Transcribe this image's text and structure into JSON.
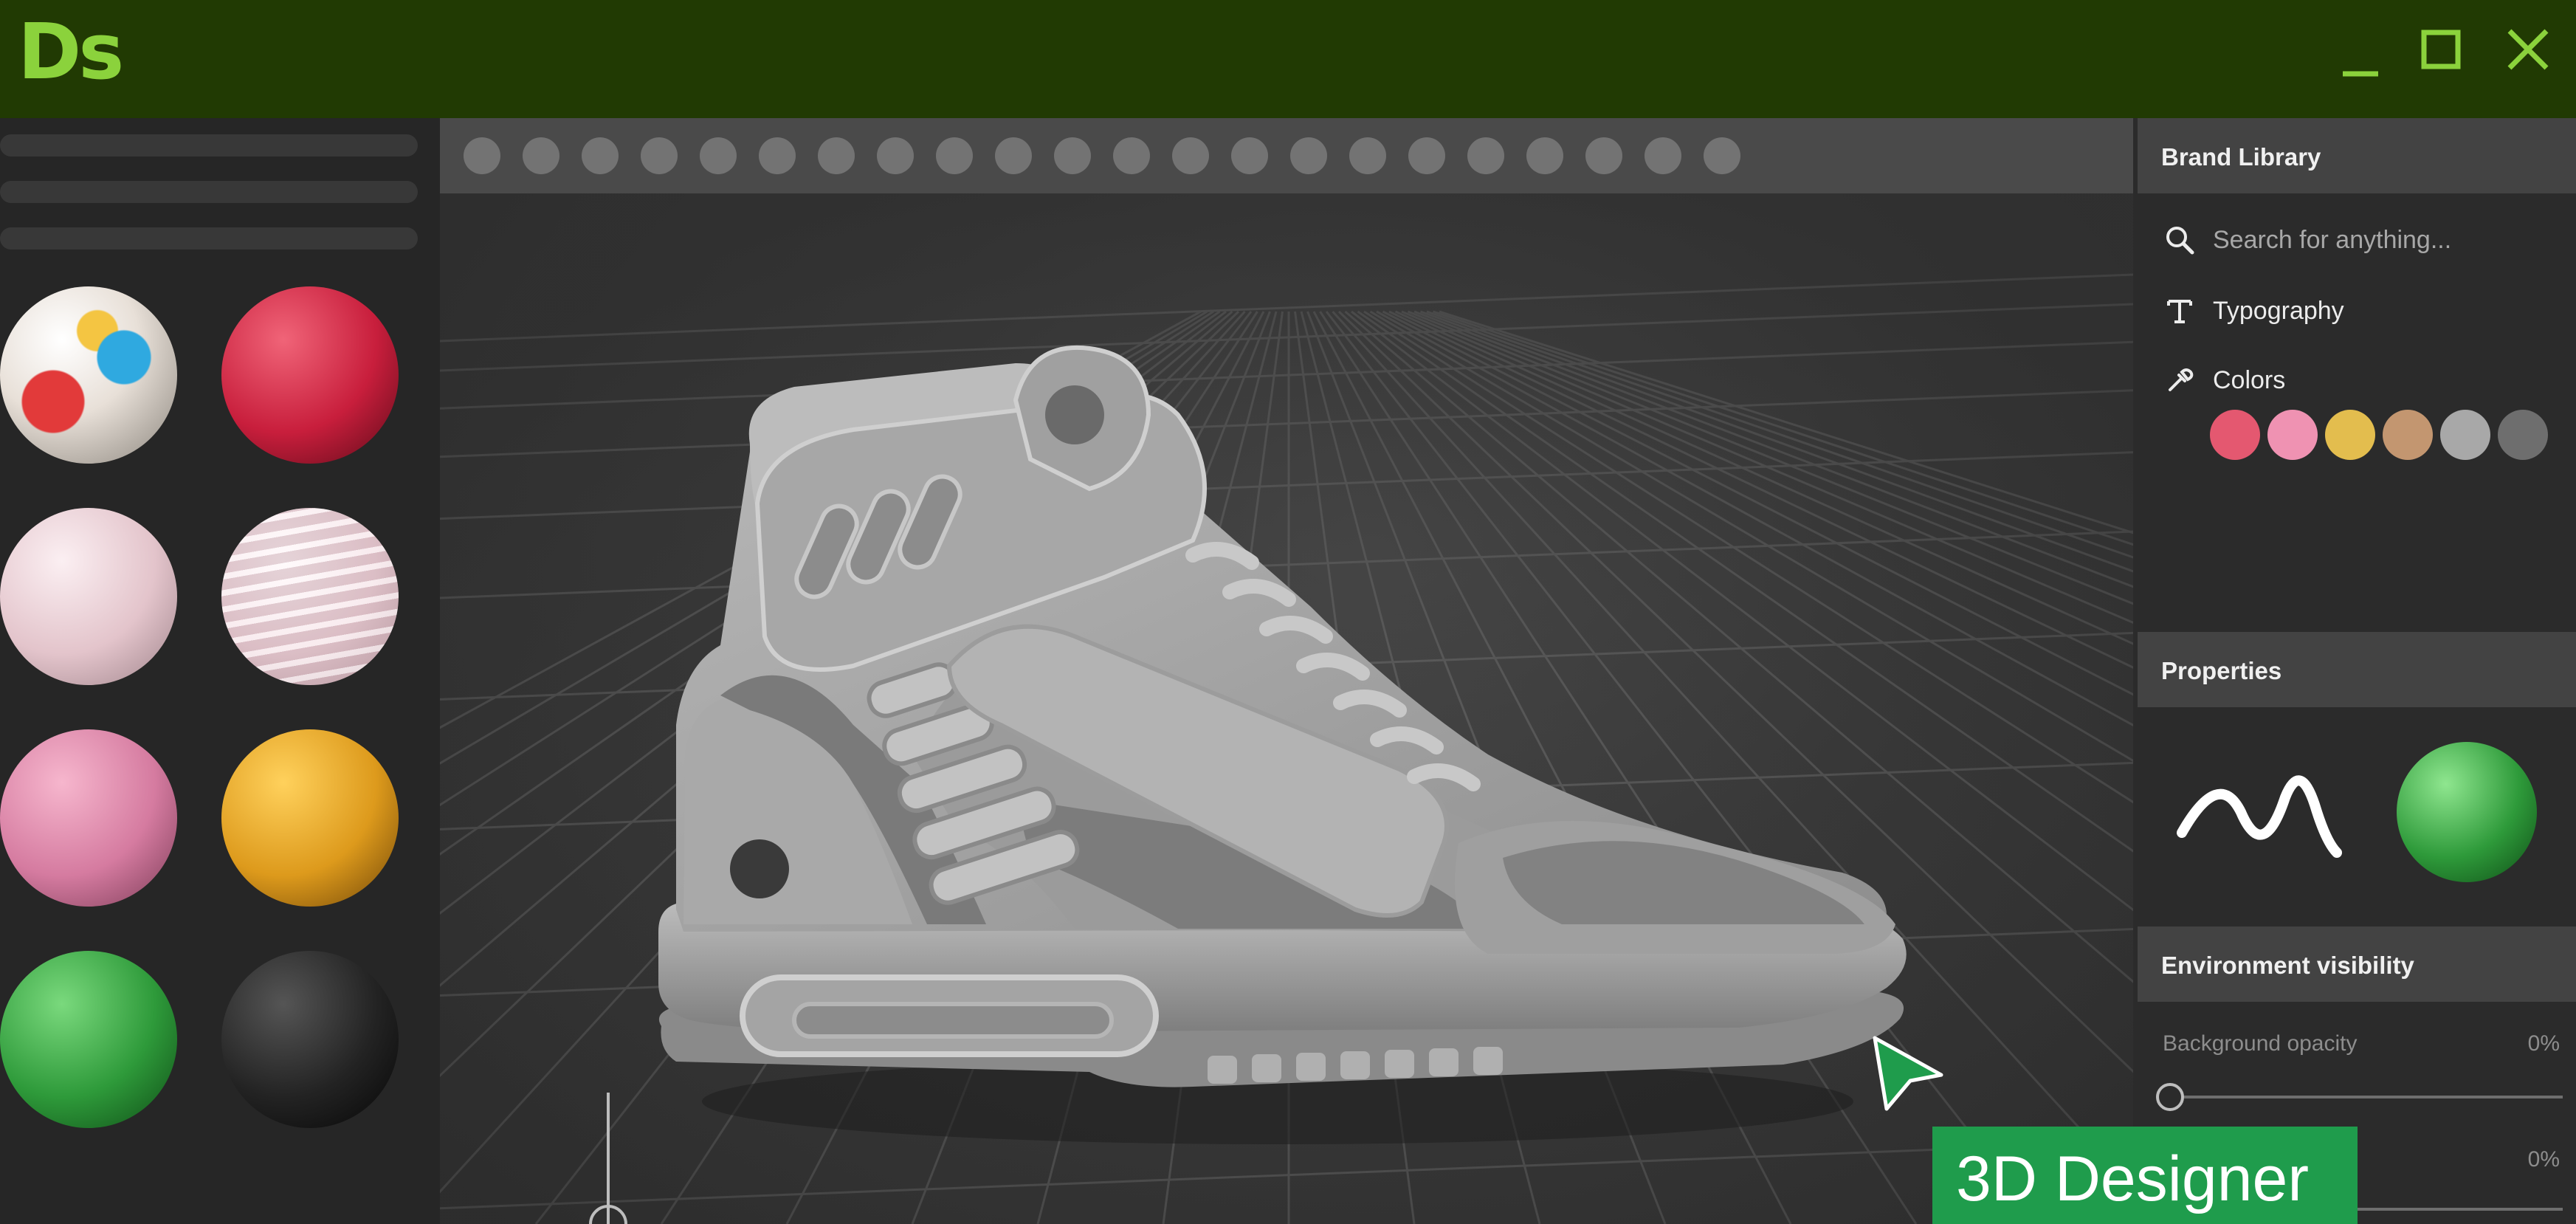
{
  "app": {
    "logo_text": "Ds"
  },
  "window_controls": [
    "minimize-icon",
    "maximize-icon",
    "close-icon"
  ],
  "colors": {
    "titlebar": "#213a03",
    "logo": "#8bd23c",
    "accent_green": "#1f9c4c",
    "panel_header": "#434343",
    "left_panel": "#262626"
  },
  "materials": [
    {
      "name": "paint-splatter-material",
      "colors": [
        "#e8e0d8",
        "#e23a3a",
        "#2fa9e0",
        "#f4c542"
      ]
    },
    {
      "name": "red-material",
      "colors": [
        "#f06478",
        "#c81e3c",
        "#5a0a18"
      ]
    },
    {
      "name": "light-pink-material",
      "colors": [
        "#fbeff2",
        "#e3c4cb",
        "#9d8289"
      ]
    },
    {
      "name": "wavy-pink-material",
      "colors": [
        "#fff4f7",
        "#f0d3da",
        "#b99aa2"
      ]
    },
    {
      "name": "pink-material",
      "colors": [
        "#f6b6cd",
        "#d57ba0",
        "#7a3a55"
      ]
    },
    {
      "name": "gold-material",
      "colors": [
        "#ffd15c",
        "#dd9a1c",
        "#6e4407"
      ]
    },
    {
      "name": "green-material",
      "colors": [
        "#7ad97d",
        "#2e9a3a",
        "#0e4a15"
      ]
    },
    {
      "name": "black-material",
      "colors": [
        "#555555",
        "#232323",
        "#050505"
      ]
    }
  ],
  "brand_library": {
    "title": "Brand Library",
    "search_placeholder": "Search for anything...",
    "typography_label": "Typography",
    "colors_label": "Colors",
    "swatches": [
      "#e45870",
      "#ef92b2",
      "#e3bd4e",
      "#c39670",
      "#a8a8a8",
      "#6e6e6e"
    ]
  },
  "properties": {
    "title": "Properties",
    "material_preview_color": "#2e9a3a"
  },
  "environment": {
    "title": "Environment visibility",
    "background_opacity_label": "Background opacity",
    "background_opacity_value": "0%",
    "background_opacity_level": 0,
    "second_value": "0%"
  },
  "caption": "3D Designer"
}
